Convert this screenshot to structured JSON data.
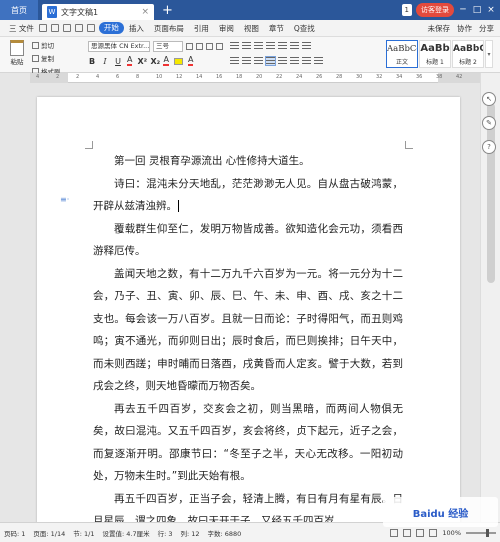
{
  "titlebar": {
    "home_tab": "首页",
    "doc_tab": "文字文稿1",
    "doc_icon": "W",
    "close": "×",
    "add": "+",
    "window_num": "1",
    "login": "访客登录",
    "min": "─",
    "max": "□",
    "win_close": "×"
  },
  "menubar": {
    "file": "三 文件",
    "items": [
      "开始",
      "插入",
      "页面布局",
      "引用",
      "审阅",
      "视图",
      "章节"
    ],
    "search": "Q查找",
    "right": [
      "未保存",
      "协作",
      "分享"
    ]
  },
  "ribbon": {
    "paste": "粘贴",
    "cut": "剪切",
    "copy": "复制",
    "format_painter": "格式刷",
    "font_name": "思源黑体 CN Extr...",
    "font_size": "三号",
    "styles": [
      {
        "preview": "AaBbCc",
        "name": "正文"
      },
      {
        "preview": "AaBb",
        "name": "标题 1"
      },
      {
        "preview": "AaBbC",
        "name": "标题 2"
      }
    ]
  },
  "ruler": {
    "numbers": [
      "4",
      "2",
      "2",
      "4",
      "6",
      "8",
      "10",
      "12",
      "14",
      "16",
      "18",
      "20",
      "22",
      "24",
      "26",
      "28",
      "30",
      "32",
      "34",
      "36",
      "38",
      "42"
    ]
  },
  "document": {
    "paragraphs": [
      "第一回 灵根育孕源流出 心性修持大道生。",
      "诗曰：混沌未分天地乱，茫茫渺渺无人见。自从盘古破鸿蒙，开辟从兹清浊辨。",
      "覆载群生仰至仁，发明万物皆成善。欲知造化会元功，须看西游释厄传。",
      "盖闻天地之数，有十二万九千六百岁为一元。将一元分为十二会，乃子、丑、寅、卯、辰、巳、午、未、申、酉、戌、亥之十二支也。每会该一万八百岁。且就一日而论：子时得阳气，而丑则鸡鸣；寅不通光，而卯则日出；辰时食后，而巳则挨排；日午天中，而未则西蹉；申时晡而日落酉，戌黄昏而人定亥。譬于大数，若到戌会之终，则天地昏曚而万物否矣。",
      "再去五千四百岁，交亥会之初，则当黑暗，而两间人物俱无矣，故曰混沌。又五千四百岁，亥会将终，贞下起元，近子之会，而复逐渐开明。邵康节曰：“冬至子之半，天心无改移。一阳初动处，万物未生时。”到此天始有根。",
      "再五千四百岁，正当子会，轻清上腾，有日有月有星有辰。日月星辰，谓之四象。故曰天开于子。又经五千四百岁"
    ]
  },
  "statusbar": {
    "page": "页码: 1",
    "pages": "页面: 1/14",
    "section": "节: 1/1",
    "position": "设置值: 4.7厘米",
    "row": "行: 3",
    "col": "列: 12",
    "words": "字数: 6880",
    "zoom": "100%"
  },
  "watermark": "Baidu 经验"
}
